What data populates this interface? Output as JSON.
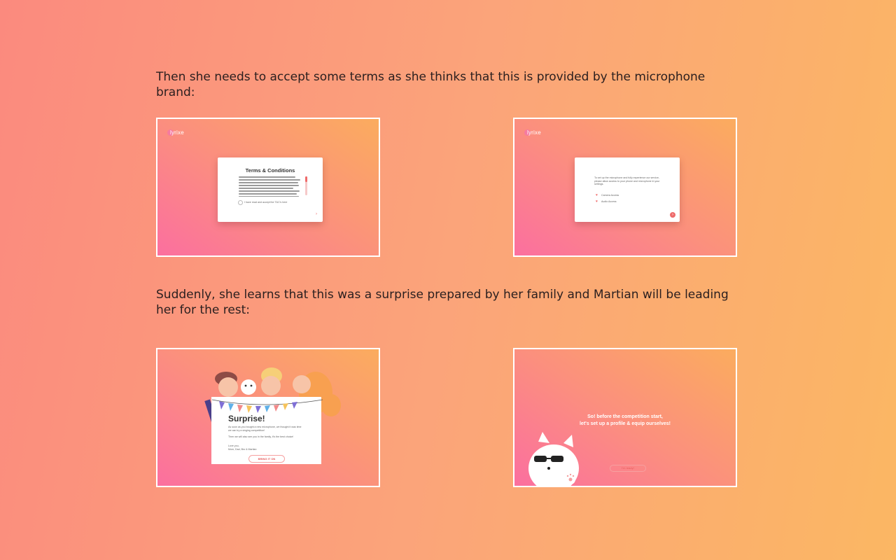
{
  "captions": {
    "first": "Then she needs to accept some terms as she thinks that this is provided by the microphone brand:",
    "second": "Suddenly, she learns that this was a surprise prepared by her family and Martian will be leading her for the rest:"
  },
  "screens": {
    "terms": {
      "logo": "lyrixe",
      "title": "Terms & Conditions",
      "checkbox_label": "I have read and accept the T&C’s here",
      "arrow": "›"
    },
    "permissions": {
      "logo": "lyrixe",
      "intro": "To set up the microphone and fully experience our service, please allow access to your phone and microphone in your settings.",
      "items": [
        "Camera Access",
        "Audio Access"
      ],
      "next": "›"
    },
    "surprise": {
      "title": "Surprise!",
      "body1": "As soon as you bought a new microphone, we thought it was time we can try a singing competition!",
      "body2": "Then we will also see you in the family, it's the best choice!",
      "signoff": "Love you,",
      "signature": "Mom, Dad, Bro & Martian",
      "button": "BRING IT ON"
    },
    "setup": {
      "line1": "So! before the competition start,",
      "line2": "let's set up a profile & equip ourselves!",
      "button": "I'm ready!"
    }
  },
  "colors": {
    "page_gradient": [
      "#fb8a7e",
      "#fba47a",
      "#fbb763"
    ],
    "shot_gradient": [
      "#fb6f9f",
      "#fb8f7e",
      "#fbac5e"
    ],
    "accent": "#ef6a6a"
  }
}
